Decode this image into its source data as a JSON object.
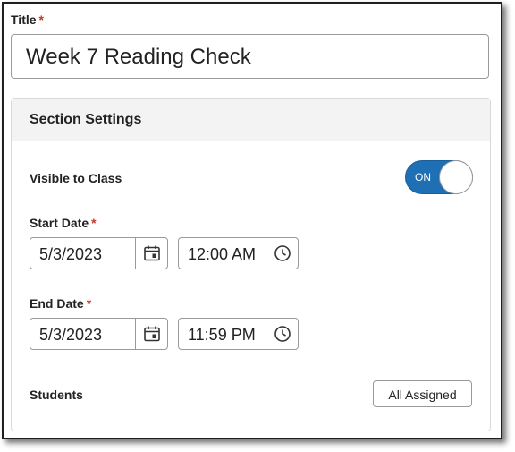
{
  "title": {
    "label": "Title",
    "required_mark": "*",
    "value": "Week 7 Reading Check"
  },
  "section": {
    "header": "Section Settings"
  },
  "visible": {
    "label": "Visible to Class",
    "toggle_text": "ON",
    "state": true
  },
  "start": {
    "label": "Start Date",
    "required_mark": "*",
    "date": "5/3/2023",
    "time": "12:00 AM"
  },
  "end": {
    "label": "End Date",
    "required_mark": "*",
    "date": "5/3/2023",
    "time": "11:59 PM"
  },
  "students": {
    "label": "Students",
    "button": "All Assigned"
  },
  "colors": {
    "accent": "#1f6fb5",
    "required": "#c0392b"
  },
  "icons": {
    "date": "calendar-icon",
    "time": "clock-icon"
  }
}
